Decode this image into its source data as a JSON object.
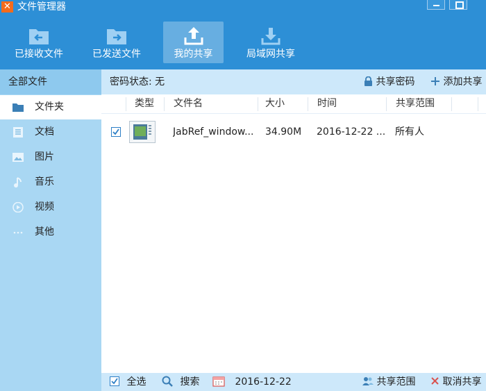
{
  "window": {
    "title": "文件管理器"
  },
  "toolbar": {
    "items": [
      {
        "label": "已接收文件",
        "icon": "received-folder-icon"
      },
      {
        "label": "已发送文件",
        "icon": "sent-folder-icon"
      },
      {
        "label": "我的共享",
        "icon": "upload-share-icon",
        "active": true
      },
      {
        "label": "局域网共享",
        "icon": "download-lan-icon"
      }
    ]
  },
  "sidebar": {
    "header": "全部文件",
    "items": [
      {
        "label": "文件夹",
        "icon": "folder-icon",
        "active": true
      },
      {
        "label": "文档",
        "icon": "document-icon"
      },
      {
        "label": "图片",
        "icon": "picture-icon"
      },
      {
        "label": "音乐",
        "icon": "music-note-icon"
      },
      {
        "label": "视频",
        "icon": "video-play-icon"
      },
      {
        "label": "其他",
        "icon": "more-icon"
      }
    ]
  },
  "main": {
    "password_status": "密码状态: 无",
    "share_password": "共享密码",
    "add_share": "添加共享",
    "columns": [
      "类型",
      "文件名",
      "大小",
      "时间",
      "共享范围"
    ],
    "rows": [
      {
        "checked": true,
        "name": "JabRef_window...",
        "size": "34.90M",
        "time": "2016-12-22 ...",
        "scope": "所有人"
      }
    ]
  },
  "footer": {
    "select_all": "全选",
    "search": "搜索",
    "date": "2016-12-22",
    "share_scope": "共享范围",
    "cancel_share": "取消共享"
  },
  "colors": {
    "primary": "#2d8fd6",
    "sidebar": "#a9d7f3",
    "header": "#cde8fa",
    "accent": "#f36b1c"
  }
}
